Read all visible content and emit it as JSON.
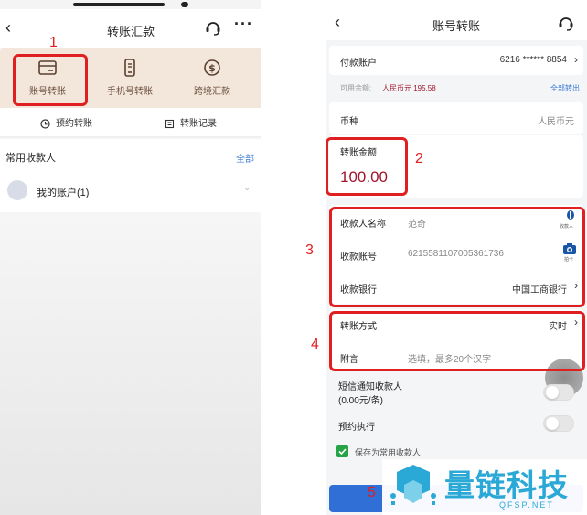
{
  "left": {
    "title": "转账汇款",
    "quick": [
      {
        "label": "账号转账",
        "icon": "card-icon"
      },
      {
        "label": "手机号转账",
        "icon": "phone-icon"
      },
      {
        "label": "跨境汇款",
        "icon": "dollar-coin-icon"
      }
    ],
    "sub": {
      "scheduled": "预约转账",
      "records": "转账记录"
    },
    "contacts": {
      "title": "常用收款人",
      "all": "全部",
      "item": "我的账户(1)"
    },
    "annotation_1": "1"
  },
  "right": {
    "title": "账号转账",
    "payer": {
      "label": "付款账户",
      "value": "6216 ****** 8854"
    },
    "balance": {
      "label": "可用余额:",
      "value": "人民币元 195.58",
      "action": "全部转出"
    },
    "currency": {
      "label": "币种",
      "value": "人民币元"
    },
    "amount": {
      "label": "转账金额",
      "value": "100.00"
    },
    "payee": {
      "name_label": "收款人名称",
      "name_value": "范奇",
      "name_icon_caption": "收款人",
      "account_label": "收款账号",
      "account_value": "6215581107005361736",
      "account_icon_caption": "拍卡",
      "bank_label": "收款银行",
      "bank_value": "中国工商银行"
    },
    "method": {
      "label": "转账方式",
      "value": "实时"
    },
    "memo": {
      "label": "附言",
      "placeholder": "选填，最多20个汉字"
    },
    "sms": {
      "label_line1": "短信通知收款人",
      "label_line2": "(0.00元/条)"
    },
    "schedule": {
      "label": "预约执行"
    },
    "save": {
      "label": "保存为常用收款人"
    },
    "annotations": [
      "2",
      "3",
      "4",
      "5"
    ]
  },
  "watermark": {
    "text": "量链科技",
    "sub": "QFSP.NET"
  },
  "colors": {
    "red": "#e02020",
    "accent": "#3a7bd5",
    "amount": "#a0162c",
    "quick_bg": "#f3e6da",
    "watermark": "#2aa8d6"
  }
}
